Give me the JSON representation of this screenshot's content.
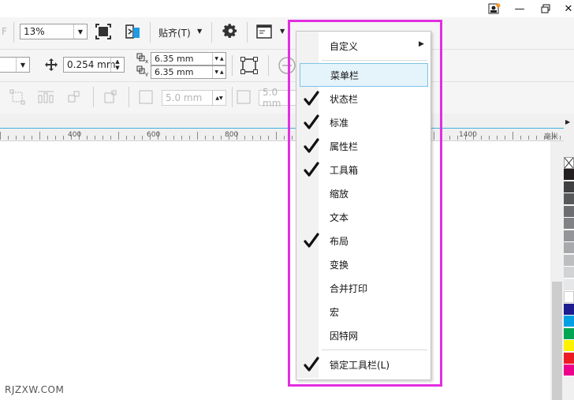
{
  "toolbar": {
    "zoom_value": "13%",
    "snap_label": "贴齐(T)",
    "nudge_value": "0.254 mm",
    "dup_x_value": "6.35 mm",
    "dup_y_value": "6.35 mm",
    "fillet_value_1": "5.0 mm",
    "fillet_value_2": "5.0 mm",
    "left_fragment": "F"
  },
  "ruler": {
    "labels": [
      "400",
      "600",
      "800",
      "1400"
    ],
    "unit": "毫米"
  },
  "menu": {
    "items": [
      {
        "label": "自定义",
        "checked": false,
        "submenu": true
      },
      {
        "label": "菜单栏",
        "checked": false,
        "highlighted": true
      },
      {
        "label": "状态栏",
        "checked": true
      },
      {
        "label": "标准",
        "checked": true
      },
      {
        "label": "属性栏",
        "checked": true
      },
      {
        "label": "工具箱",
        "checked": true
      },
      {
        "label": "缩放",
        "checked": false
      },
      {
        "label": "文本",
        "checked": false
      },
      {
        "label": "布局",
        "checked": true
      },
      {
        "label": "变换",
        "checked": false
      },
      {
        "label": "合并打印",
        "checked": false
      },
      {
        "label": "宏",
        "checked": false
      },
      {
        "label": "因特网",
        "checked": false
      },
      {
        "label": "锁定工具栏(L)",
        "checked": true
      }
    ]
  },
  "palette_colors": [
    "#231f20",
    "#414042",
    "#58595b",
    "#6d6e71",
    "#808285",
    "#939598",
    "#a7a9ac",
    "#bcbec0",
    "#d1d3d4",
    "#e6e7e8",
    "#ffffff",
    "#1d1d8f",
    "#00a0e3",
    "#00a651",
    "#fff200",
    "#ed1c24",
    "#ec008c"
  ],
  "watermark": "RJZXW.COM",
  "accent_color": "#e22ee0"
}
